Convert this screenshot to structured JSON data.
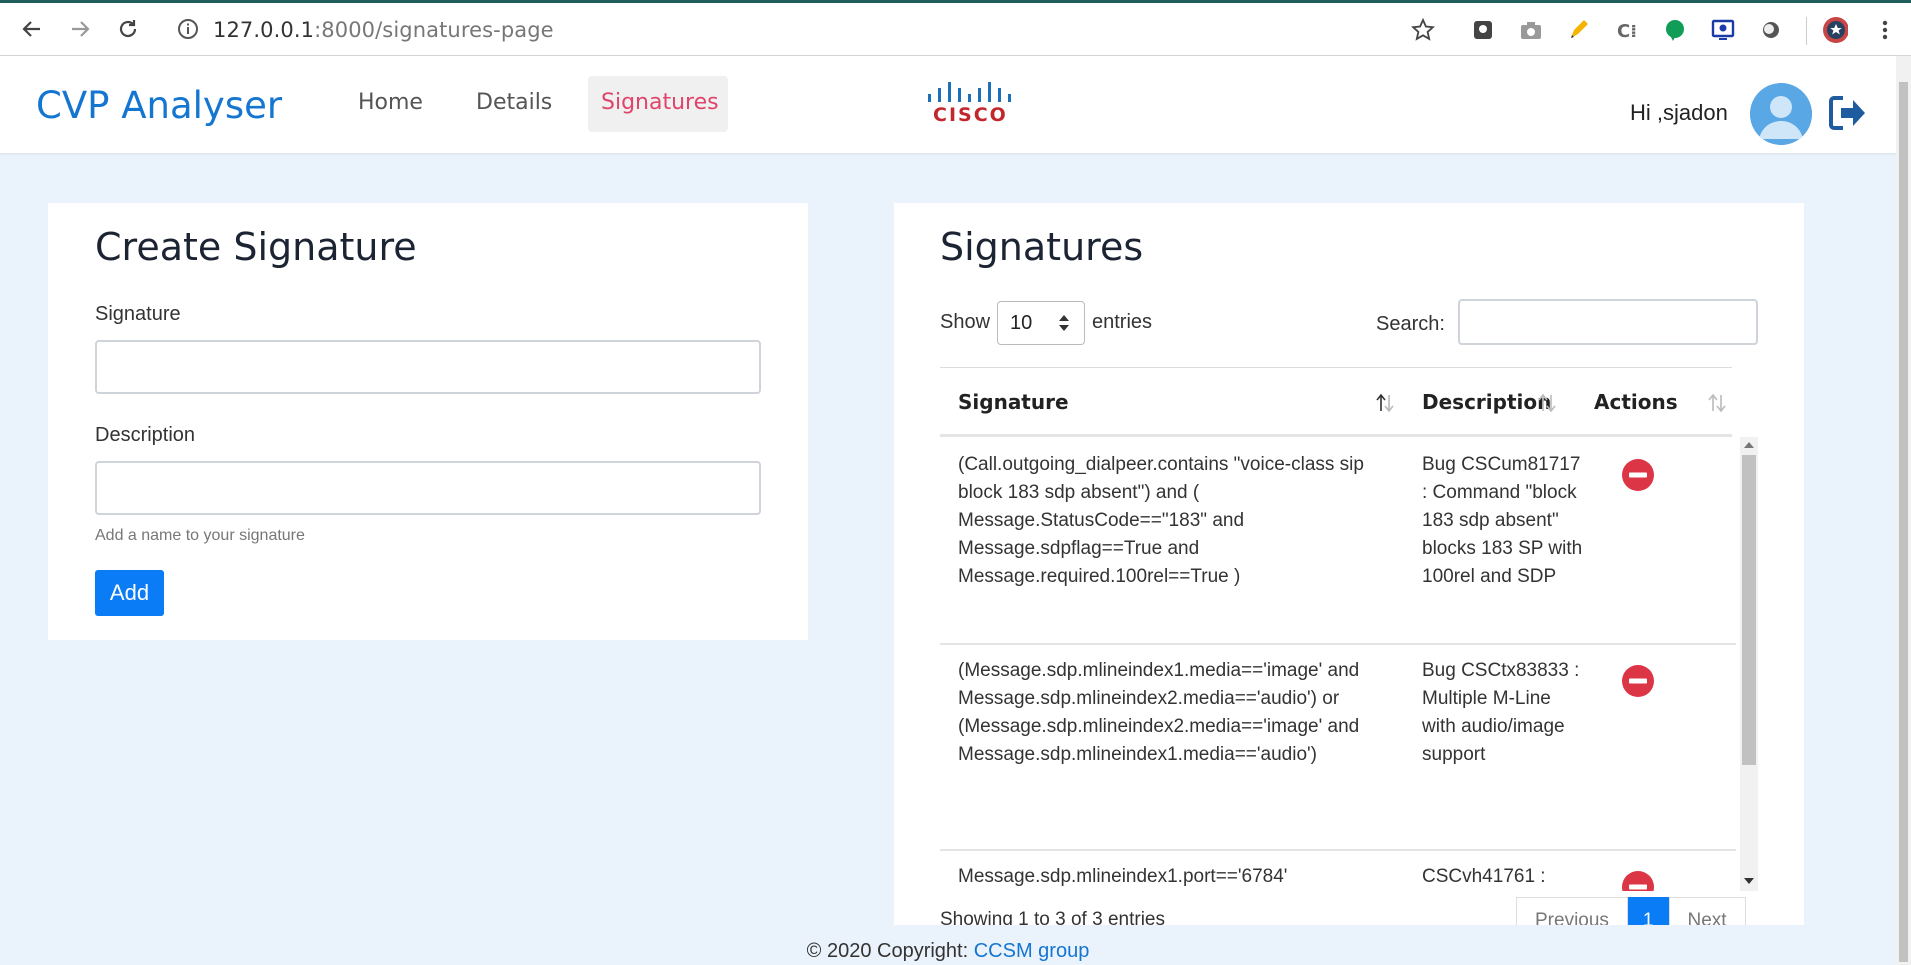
{
  "browser": {
    "url_host": "127.0.0.1",
    "url_rest": ":8000/signatures-page"
  },
  "navbar": {
    "brand": "CVP Analyser",
    "items": [
      {
        "label": "Home"
      },
      {
        "label": "Details"
      },
      {
        "label": "Signatures",
        "active": true
      }
    ],
    "logo_text": "CISCO",
    "greeting": "Hi ,sjadon"
  },
  "create_form": {
    "title": "Create Signature",
    "signature_label": "Signature",
    "signature_value": "",
    "description_label": "Description",
    "description_value": "",
    "help_text": "Add a name to your signature",
    "add_label": "Add"
  },
  "signatures": {
    "title": "Signatures",
    "show_label": "Show",
    "entries_value": "10",
    "entries_label": "entries",
    "search_label": "Search:",
    "search_value": "",
    "columns": [
      "Signature",
      "Description",
      "Actions"
    ],
    "rows": [
      {
        "signature": "(Call.outgoing_dialpeer.contains \"voice-class sip block 183 sdp absent\") and ( Message.StatusCode==\"183\" and Message.sdpflag==True and Message.required.100rel==True )",
        "description": "Bug CSCum81717 : Command \"block 183 sdp absent\" blocks 183 SP with 100rel and SDP"
      },
      {
        "signature": "(Message.sdp.mlineindex1.media=='image' and Message.sdp.mlineindex2.media=='audio') or (Message.sdp.mlineindex2.media=='image' and Message.sdp.mlineindex1.media=='audio')",
        "description": "Bug CSCtx83833 : Multiple M-Line with audio/image support"
      },
      {
        "signature": "Message.sdp.mlineindex1.port=='6784'",
        "description": "CSCvh41761 :"
      }
    ],
    "info": "Showing 1 to 3 of 3 entries",
    "pagination": {
      "previous": "Previous",
      "current": "1",
      "next": "Next"
    }
  },
  "footer": {
    "copyright": "© 2020 Copyright:",
    "link": "CCSM group"
  },
  "colors": {
    "brand_blue": "#1476d1",
    "active_pink": "#e0446b",
    "primary_button": "#0a7cf5",
    "delete_red": "#dc3545",
    "page_background": "#eaf2fb"
  },
  "icons": [
    "back-arrow-icon",
    "forward-arrow-icon",
    "reload-icon",
    "info-icon",
    "star-icon",
    "cisco-logo",
    "user-avatar-icon",
    "logout-icon",
    "sort-icon",
    "remove-circle-icon"
  ]
}
